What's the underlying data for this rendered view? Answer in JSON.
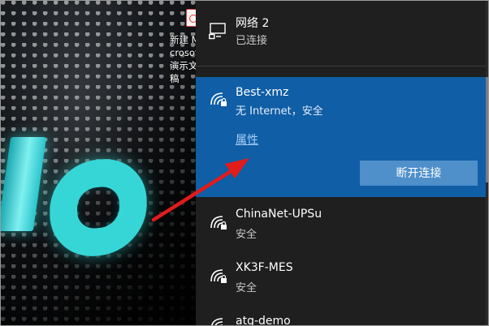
{
  "desktop": {
    "icon_label": "新建 Microsoft 演示文稿"
  },
  "network_flyout": {
    "ethernet": {
      "name": "网络  2",
      "status": "已连接",
      "icon": "ethernet-icon"
    },
    "selected": {
      "name": "Best-xmz",
      "status": "无 Internet，安全",
      "properties_link": "属性",
      "disconnect_label": "断开连接",
      "icon": "wifi-secure-icon"
    },
    "networks": [
      {
        "name": "ChinaNet-UPSu",
        "status": "安全",
        "icon": "wifi-secure-icon"
      },
      {
        "name": "XK3F-MES",
        "status": "安全",
        "icon": "wifi-secure-icon"
      },
      {
        "name": "atg-demo",
        "status": "",
        "icon": "wifi-secure-icon"
      }
    ]
  },
  "colors": {
    "flyout_bg": "#1f1f1f",
    "selected_bg": "#0f5ea6",
    "button_bg": "#4f8fca",
    "link": "#a8cff5",
    "arrow": "#e21b1b"
  }
}
